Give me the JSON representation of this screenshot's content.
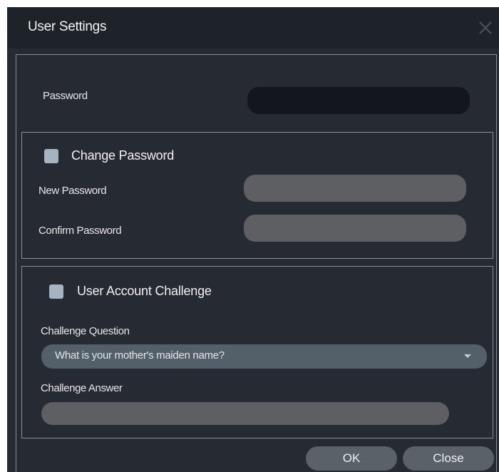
{
  "dialog": {
    "title": "User Settings"
  },
  "password_section": {
    "password_label": "Password",
    "password_value": ""
  },
  "change_password": {
    "checkbox_label": "Change Password",
    "checked": false,
    "new_password_label": "New Password",
    "new_password_value": "",
    "confirm_password_label": "Confirm Password",
    "confirm_password_value": ""
  },
  "challenge": {
    "checkbox_label": "User Account Challenge",
    "checked": false,
    "question_label": "Challenge Question",
    "question_selected": "What is your mother's maiden name?",
    "answer_label": "Challenge Answer",
    "answer_value": ""
  },
  "footer": {
    "ok_label": "OK",
    "close_label": "Close"
  },
  "colors": {
    "dialog_bg": "#262b33",
    "titlebar_bg": "#1e232a",
    "checkbox": "#a6b3c1",
    "button_bg": "#5a6168"
  }
}
